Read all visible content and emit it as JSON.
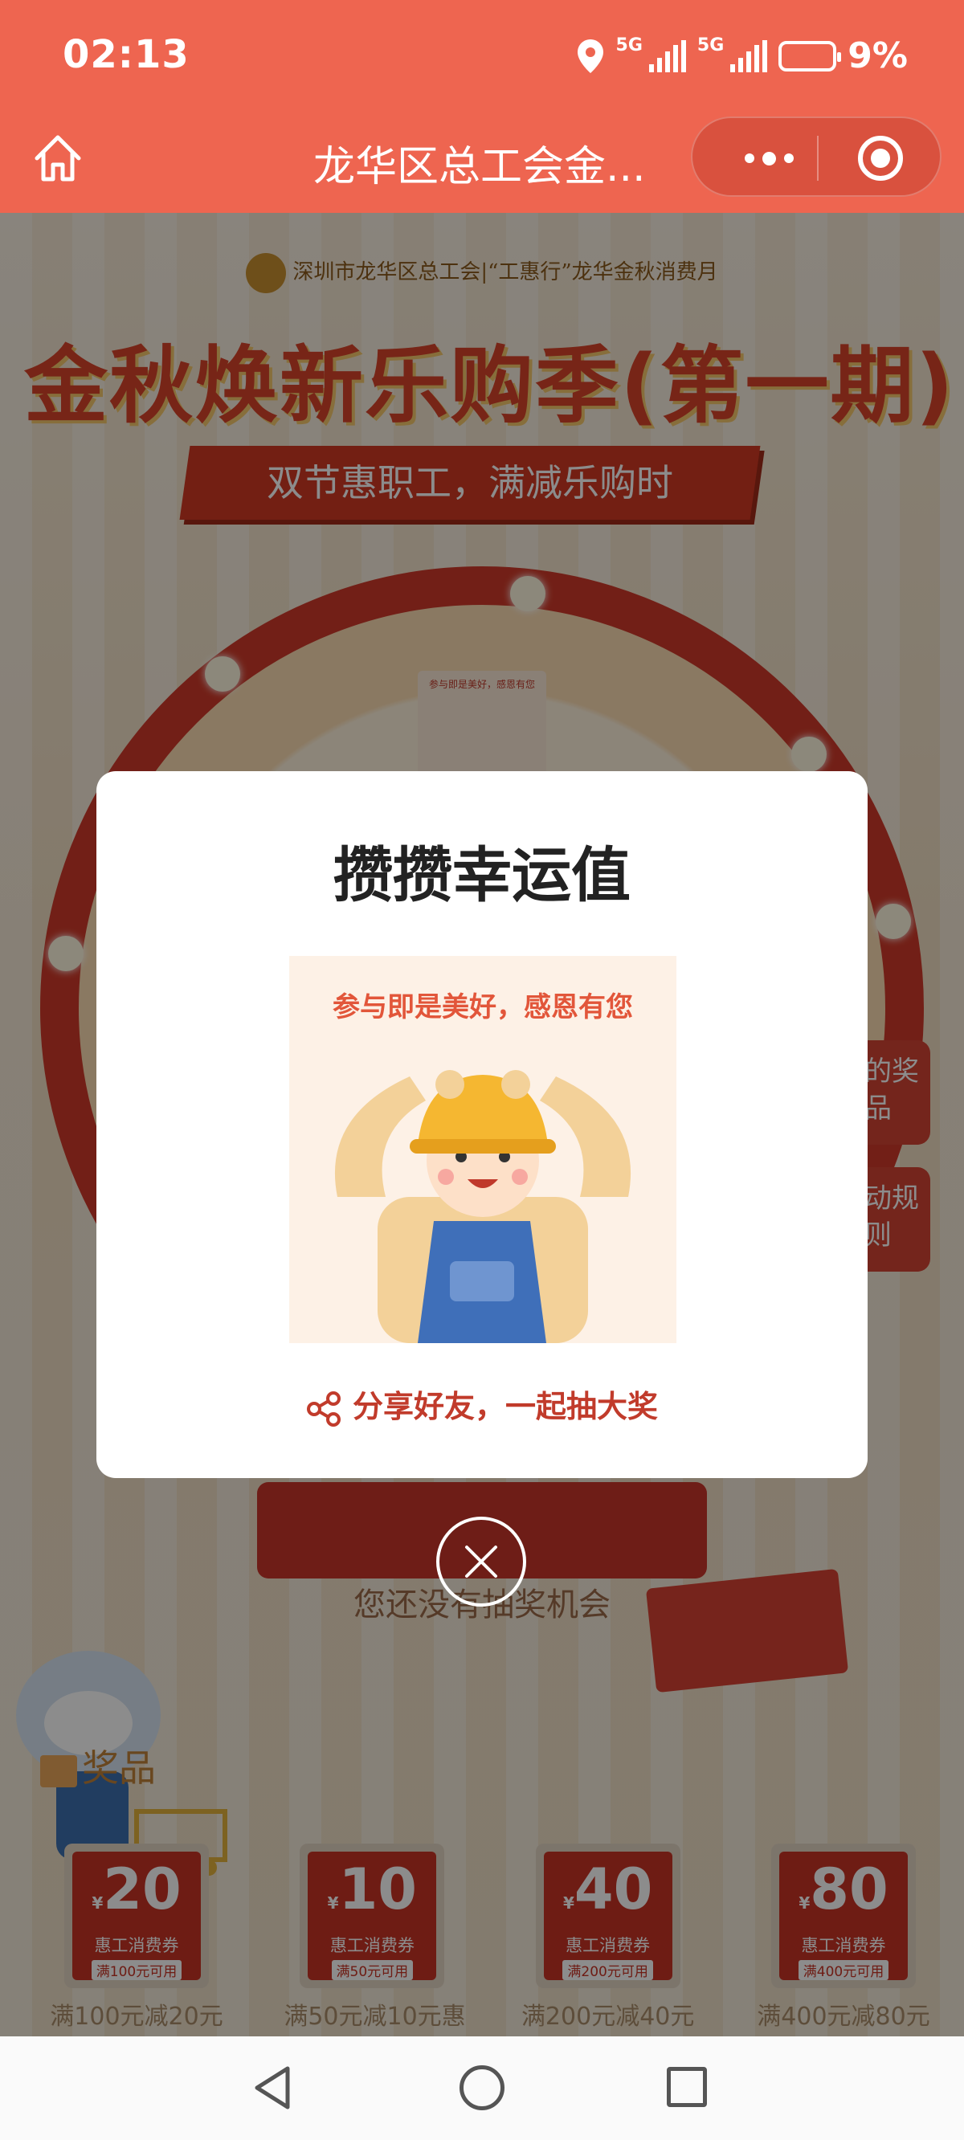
{
  "status_bar": {
    "time": "02:13",
    "network_1": "5G",
    "network_2": "5G",
    "battery": "9%"
  },
  "title_bar": {
    "title": "龙华区总工会金..."
  },
  "background": {
    "org_line": "深圳市龙华区总工会|“工惠行”龙华金秋消费月",
    "main_title": "金秋焕新乐购季(第一期)",
    "subtitle": "双节惠职工，满减乐购时",
    "wheel_card_text": "参与即是美好，感恩有您",
    "my_prize": "我的奖品",
    "rules": "活动规则",
    "coupon_label": "消费券",
    "no_chance": "您还没有抽奖机会",
    "prizes_heading": "奖品",
    "prizes": [
      {
        "currency": "¥",
        "amount": "20",
        "type": "惠工消费券",
        "condition": "满100元可用",
        "name": "满100元减20元"
      },
      {
        "currency": "¥",
        "amount": "10",
        "type": "惠工消费券",
        "condition": "满50元可用",
        "name": "满50元减10元惠"
      },
      {
        "currency": "¥",
        "amount": "40",
        "type": "惠工消费券",
        "condition": "满200元可用",
        "name": "满200元减40元"
      },
      {
        "currency": "¥",
        "amount": "80",
        "type": "惠工消费券",
        "condition": "满400元可用",
        "name": "满400元减80元"
      }
    ]
  },
  "modal": {
    "title": "攒攒幸运值",
    "image_caption": "参与即是美好，感恩有您",
    "share_text": "分享好友，一起抽大奖"
  },
  "colors": {
    "brand": "#ee6550",
    "modal_accent": "#c13b2b"
  }
}
